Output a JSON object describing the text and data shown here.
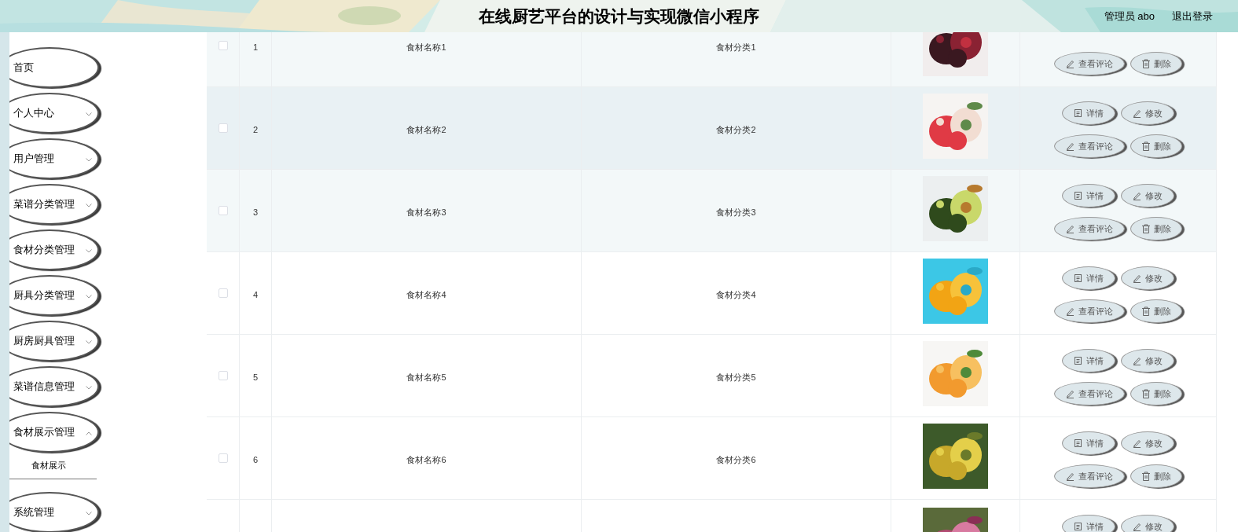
{
  "header": {
    "title": "在线厨艺平台的设计与实现微信小程序",
    "user": "管理员 abo",
    "logout": "退出登录"
  },
  "sidebar": {
    "items": [
      {
        "label": "首页",
        "has_submenu": false
      },
      {
        "label": "个人中心",
        "has_submenu": true,
        "expanded": false
      },
      {
        "label": "用户管理",
        "has_submenu": true,
        "expanded": false
      },
      {
        "label": "菜谱分类管理",
        "has_submenu": true,
        "expanded": false
      },
      {
        "label": "食材分类管理",
        "has_submenu": true,
        "expanded": false
      },
      {
        "label": "厨具分类管理",
        "has_submenu": true,
        "expanded": false
      },
      {
        "label": "厨房厨具管理",
        "has_submenu": true,
        "expanded": false
      },
      {
        "label": "菜谱信息管理",
        "has_submenu": true,
        "expanded": false
      },
      {
        "label": "食材展示管理",
        "has_submenu": true,
        "expanded": true,
        "children": [
          {
            "label": "食材展示"
          }
        ]
      },
      {
        "label": "系统管理",
        "has_submenu": true,
        "expanded": false
      }
    ]
  },
  "table": {
    "rows": [
      {
        "index": "1",
        "name": "食材名称1",
        "category": "食材分类1",
        "hovered": false,
        "striped": true,
        "actions": [
          {
            "kind": "comments",
            "label": "查看评论"
          },
          {
            "kind": "delete",
            "label": "删除"
          }
        ]
      },
      {
        "index": "2",
        "name": "食材名称2",
        "category": "食材分类2",
        "hovered": true,
        "striped": false,
        "actions": [
          {
            "kind": "detail",
            "label": "详情"
          },
          {
            "kind": "edit",
            "label": "修改"
          },
          {
            "kind": "comments",
            "label": "查看评论"
          },
          {
            "kind": "delete",
            "label": "删除"
          }
        ]
      },
      {
        "index": "3",
        "name": "食材名称3",
        "category": "食材分类3",
        "hovered": false,
        "striped": true,
        "actions": [
          {
            "kind": "detail",
            "label": "详情"
          },
          {
            "kind": "edit",
            "label": "修改"
          },
          {
            "kind": "comments",
            "label": "查看评论"
          },
          {
            "kind": "delete",
            "label": "删除"
          }
        ]
      },
      {
        "index": "4",
        "name": "食材名称4",
        "category": "食材分类4",
        "hovered": false,
        "striped": false,
        "actions": [
          {
            "kind": "detail",
            "label": "详情"
          },
          {
            "kind": "edit",
            "label": "修改"
          },
          {
            "kind": "comments",
            "label": "查看评论"
          },
          {
            "kind": "delete",
            "label": "删除"
          }
        ]
      },
      {
        "index": "5",
        "name": "食材名称5",
        "category": "食材分类5",
        "hovered": false,
        "striped": false,
        "actions": [
          {
            "kind": "detail",
            "label": "详情"
          },
          {
            "kind": "edit",
            "label": "修改"
          },
          {
            "kind": "comments",
            "label": "查看评论"
          },
          {
            "kind": "delete",
            "label": "删除"
          }
        ]
      },
      {
        "index": "6",
        "name": "食材名称6",
        "category": "食材分类6",
        "hovered": false,
        "striped": false,
        "actions": [
          {
            "kind": "detail",
            "label": "详情"
          },
          {
            "kind": "edit",
            "label": "修改"
          },
          {
            "kind": "comments",
            "label": "查看评论"
          },
          {
            "kind": "delete",
            "label": "删除"
          }
        ]
      },
      {
        "hovered": false,
        "striped": false,
        "actions": [
          {
            "kind": "detail",
            "label": "详情"
          },
          {
            "kind": "edit",
            "label": "修改"
          }
        ]
      }
    ]
  }
}
